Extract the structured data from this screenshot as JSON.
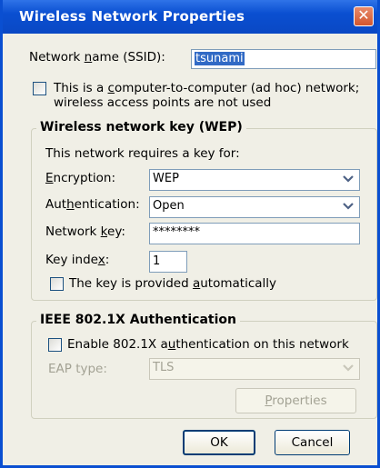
{
  "window": {
    "title": "Wireless Network Properties"
  },
  "ssid": {
    "label_pre": "Network ",
    "label_u": "n",
    "label_post": "ame (SSID):",
    "value": "tsunami"
  },
  "adhoc": {
    "line1_pre": "This is a ",
    "line1_u": "c",
    "line1_post": "omputer-to-computer (ad hoc) network;",
    "line2": "wireless access points are not used"
  },
  "wep": {
    "group_title": "Wireless network key (WEP)",
    "requires_text": "This network requires a key for:",
    "encryption": {
      "label_u": "E",
      "label_post": "ncryption:",
      "value": "WEP"
    },
    "authentication": {
      "label_pre": "Aut",
      "label_u": "h",
      "label_post": "entication:",
      "value": "Open"
    },
    "network_key": {
      "label_pre": "Network ",
      "label_u": "k",
      "label_post": "ey:",
      "value": "********"
    },
    "key_index": {
      "label_pre": "Key inde",
      "label_u": "x",
      "label_post": ":",
      "value": "1"
    },
    "auto_key": {
      "label_pre": "The key is provided ",
      "label_u": "a",
      "label_post": "utomatically"
    }
  },
  "ieee": {
    "group_title": "IEEE 802.1X Authentication",
    "enable": {
      "label_pre": "Enable 802.1X a",
      "label_u": "u",
      "label_post": "thentication on this network"
    },
    "eap_label": "EAP type:",
    "eap_value": "TLS",
    "properties_pre": "",
    "properties_u": "P",
    "properties_post": "roperties"
  },
  "buttons": {
    "ok": "OK",
    "cancel": "Cancel"
  },
  "colors": {
    "titlebar": "#0a4fd1",
    "dialog_bg": "#f0efe6",
    "selection": "#316ac5"
  }
}
